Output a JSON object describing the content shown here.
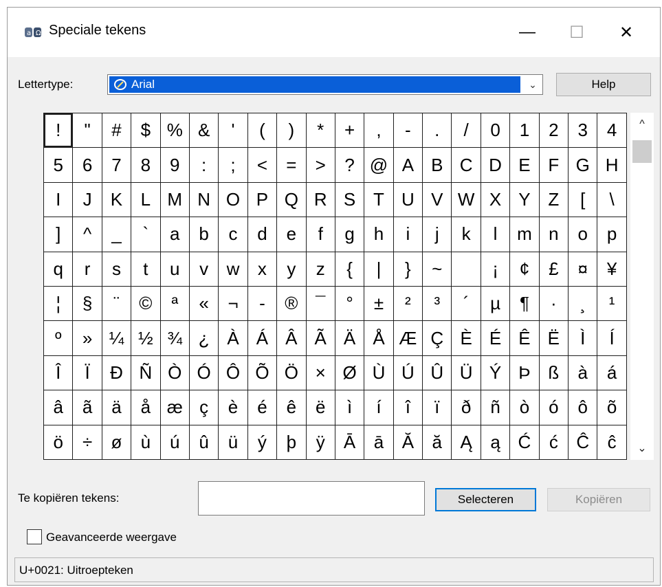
{
  "window": {
    "title": "Speciale tekens",
    "min_symbol": "—",
    "max_symbol": "☐",
    "close_symbol": "✕"
  },
  "font": {
    "label": "Lettertype:",
    "selected": "Arial",
    "help_label": "Help"
  },
  "grid": {
    "rows": [
      [
        "!",
        "\"",
        "#",
        "$",
        "%",
        "&",
        "'",
        "(",
        ")",
        "*",
        "+",
        ",",
        "-",
        ".",
        "/",
        "0",
        "1",
        "2",
        "3",
        "4"
      ],
      [
        "5",
        "6",
        "7",
        "8",
        "9",
        ":",
        ";",
        "<",
        "=",
        ">",
        "?",
        "@",
        "A",
        "B",
        "C",
        "D",
        "E",
        "F",
        "G",
        "H"
      ],
      [
        "I",
        "J",
        "K",
        "L",
        "M",
        "N",
        "O",
        "P",
        "Q",
        "R",
        "S",
        "T",
        "U",
        "V",
        "W",
        "X",
        "Y",
        "Z",
        "[",
        "\\"
      ],
      [
        "]",
        "^",
        "_",
        "`",
        "a",
        "b",
        "c",
        "d",
        "e",
        "f",
        "g",
        "h",
        "i",
        "j",
        "k",
        "l",
        "m",
        "n",
        "o",
        "p"
      ],
      [
        "q",
        "r",
        "s",
        "t",
        "u",
        "v",
        "w",
        "x",
        "y",
        "z",
        "{",
        "|",
        "}",
        "~",
        " ",
        "¡",
        "¢",
        "£",
        "¤",
        "¥"
      ],
      [
        "¦",
        "§",
        "¨",
        "©",
        "ª",
        "«",
        "¬",
        "-",
        "®",
        "¯",
        "°",
        "±",
        "²",
        "³",
        "´",
        "µ",
        "¶",
        "·",
        "¸",
        "¹"
      ],
      [
        "º",
        "»",
        "¼",
        "½",
        "¾",
        "¿",
        "À",
        "Á",
        "Â",
        "Ã",
        "Ä",
        "Å",
        "Æ",
        "Ç",
        "È",
        "É",
        "Ê",
        "Ë",
        "Ì",
        "Í"
      ],
      [
        "Î",
        "Ï",
        "Ð",
        "Ñ",
        "Ò",
        "Ó",
        "Ô",
        "Õ",
        "Ö",
        "×",
        "Ø",
        "Ù",
        "Ú",
        "Û",
        "Ü",
        "Ý",
        "Þ",
        "ß",
        "à",
        "á"
      ],
      [
        "â",
        "ã",
        "ä",
        "å",
        "æ",
        "ç",
        "è",
        "é",
        "ê",
        "ë",
        "ì",
        "í",
        "î",
        "ï",
        "ð",
        "ñ",
        "ò",
        "ó",
        "ô",
        "õ"
      ],
      [
        "ö",
        "÷",
        "ø",
        "ù",
        "ú",
        "û",
        "ü",
        "ý",
        "þ",
        "ÿ",
        "Ā",
        "ā",
        "Ă",
        "ă",
        "Ą",
        "ą",
        "Ć",
        "ć",
        "Ĉ",
        "ĉ"
      ]
    ],
    "focused": "!"
  },
  "scrollbar": {
    "up_symbol": "^",
    "down_symbol": "⌄"
  },
  "copy": {
    "label": "Te kopiëren tekens:",
    "value": "",
    "select_label": "Selecteren",
    "copy_label": "Kopiëren"
  },
  "advanced": {
    "label": "Geavanceerde weergave",
    "checked": false
  },
  "status": {
    "text": "U+0021: Uitroepteken"
  }
}
